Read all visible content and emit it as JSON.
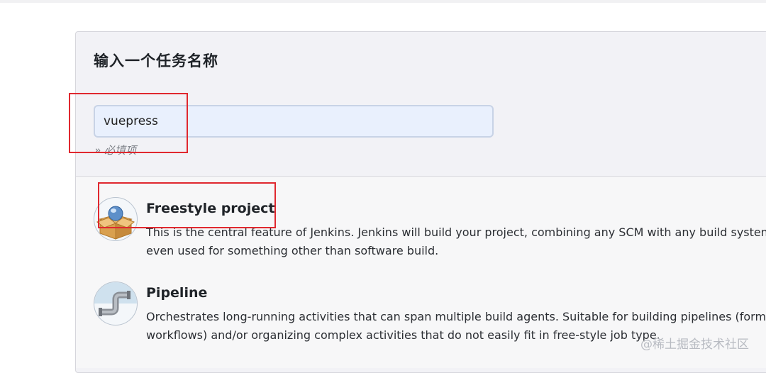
{
  "form": {
    "heading": "输入一个任务名称",
    "item_name_value": "vuepress",
    "required_hint": "» 必填项"
  },
  "job_types": [
    {
      "title": "Freestyle project",
      "icon": "freestyle-box-icon",
      "desc_line1": "This is the central feature of Jenkins. Jenkins will build your project, combining any SCM with any build system",
      "desc_line2": "even used for something other than software build."
    },
    {
      "title": "Pipeline",
      "icon": "pipeline-pipe-icon",
      "desc_line1": "Orchestrates long-running activities that can span multiple build agents. Suitable for building pipelines (form",
      "desc_line2": "workflows) and/or organizing complex activities that do not easily fit in free-style job type."
    }
  ],
  "watermark": "@稀土掘金技术社区",
  "colors": {
    "highlight": "#e0282f",
    "input_bg": "#e9f0fd",
    "panel_bg": "#f2f2f6"
  }
}
